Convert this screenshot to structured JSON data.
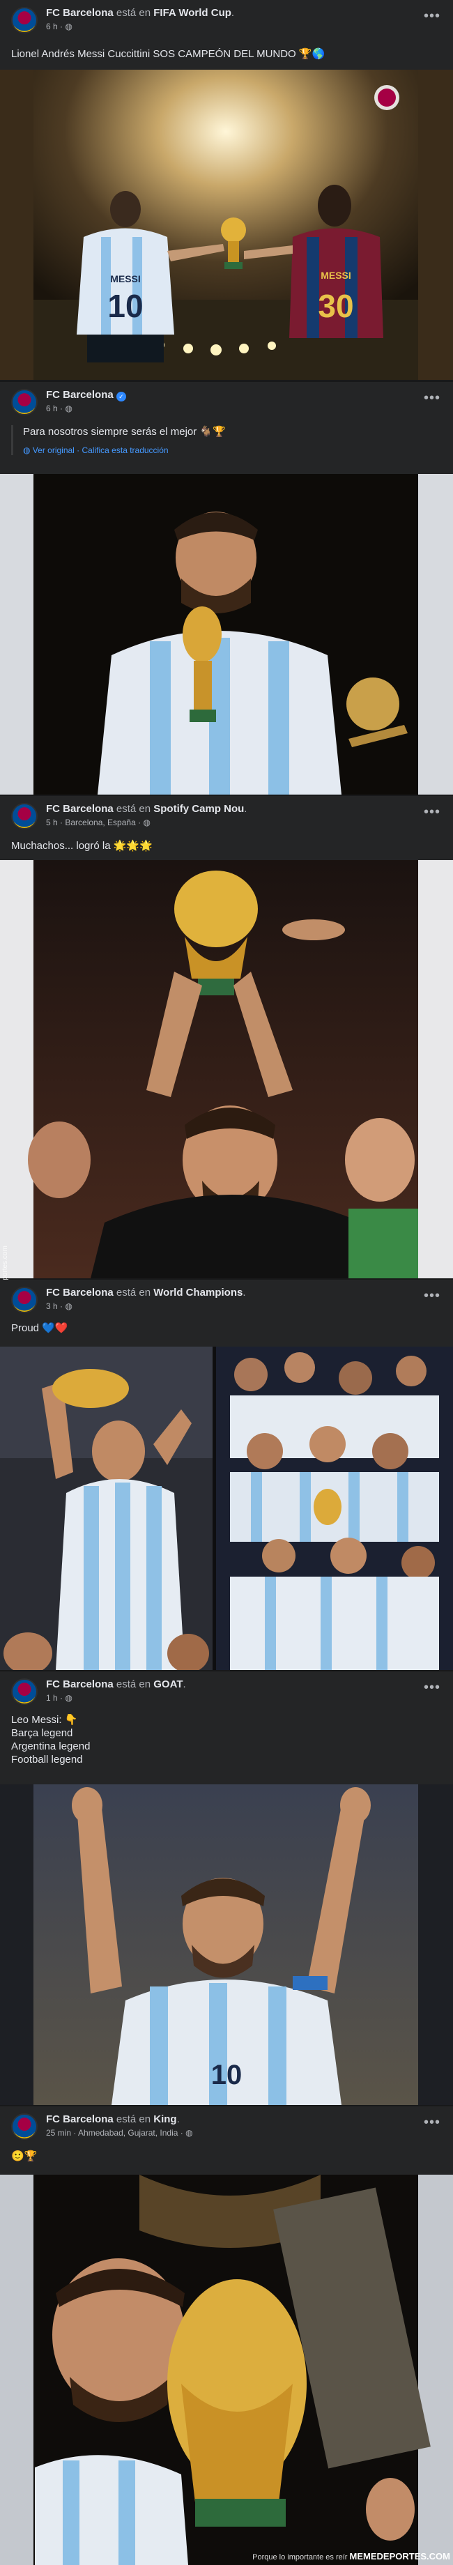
{
  "posts": [
    {
      "author": "FC Barcelona",
      "connector": "está en",
      "location": "FIFA World Cup",
      "meta": "6 h · ◍",
      "text_lines": [
        "Lionel Andrés Messi Cuccittini SOS CAMPEÓN DEL MUNDO 🏆🌎"
      ]
    },
    {
      "author": "FC Barcelona",
      "meta": "6 h · ◍",
      "quote": "Para nosotros siempre serás el mejor 🐐🏆",
      "translation": "◍ Ver original · Califica esta traducción"
    },
    {
      "author": "FC Barcelona",
      "connector": "está en",
      "location": "Spotify Camp Nou",
      "meta": "5 h · Barcelona, España · ◍",
      "text_lines": [
        "Muchachos... logró la 🌟🌟🌟"
      ]
    },
    {
      "author": "FC Barcelona",
      "connector": "está en",
      "location": "World Champions",
      "meta": "3 h · ◍",
      "text_lines": [
        "Proud 💙❤️"
      ]
    },
    {
      "author": "FC Barcelona",
      "connector": "está en",
      "location": "GOAT",
      "meta": "1 h · ◍",
      "text_lines": [
        "Leo Messi: 👇",
        "Barça legend",
        "Argentina legend",
        "Football legend"
      ]
    },
    {
      "author": "FC Barcelona",
      "connector": "está en",
      "location": "King",
      "meta": "25 min · Ahmedabad, Gujarat, India · ◍",
      "text_lines": [
        "🙂🏆"
      ]
    }
  ],
  "more_icon": "•••",
  "side_watermark": "Mmedeportes.com",
  "footer_watermark": {
    "prefix": "Porque lo importante es reír",
    "brand": "MEMEDEPORTES.COM"
  },
  "photo_labels": {
    "messi_shirt": "MESSI",
    "messi_number": "10",
    "retro_shirt": "MESSI",
    "retro_number": "30"
  },
  "colors": {
    "bg": "#18191a",
    "card": "#242526",
    "text": "#e4e6eb",
    "muted": "#b0b3b8",
    "link": "#4599ff"
  }
}
